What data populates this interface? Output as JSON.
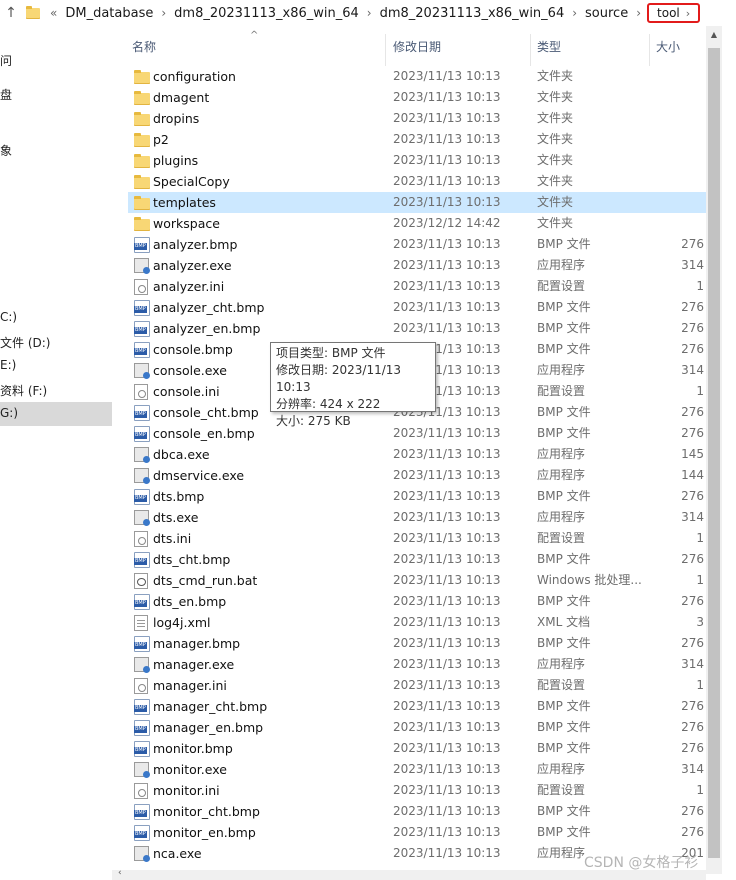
{
  "address_bar": {
    "back_glyph": "«",
    "crumbs": [
      "DM_database",
      "dm8_20231113_x86_win_64",
      "dm8_20231113_x86_win_64",
      "source"
    ],
    "active_crumb": "tool"
  },
  "nav_pane": {
    "items": [
      "问",
      "盘",
      "象",
      "C:)",
      "文件 (D:)",
      "E:)",
      "资料 (F:)",
      "G:)"
    ]
  },
  "columns": {
    "name": "名称",
    "date": "修改日期",
    "type": "类型",
    "size": "大小"
  },
  "files": [
    {
      "name": "configuration",
      "date": "2023/11/13 10:13",
      "type": "文件夹",
      "size": "",
      "icon": "folder-icon"
    },
    {
      "name": "dmagent",
      "date": "2023/11/13 10:13",
      "type": "文件夹",
      "size": "",
      "icon": "folder-icon"
    },
    {
      "name": "dropins",
      "date": "2023/11/13 10:13",
      "type": "文件夹",
      "size": "",
      "icon": "folder-icon"
    },
    {
      "name": "p2",
      "date": "2023/11/13 10:13",
      "type": "文件夹",
      "size": "",
      "icon": "folder-icon"
    },
    {
      "name": "plugins",
      "date": "2023/11/13 10:13",
      "type": "文件夹",
      "size": "",
      "icon": "folder-icon"
    },
    {
      "name": "SpecialCopy",
      "date": "2023/11/13 10:13",
      "type": "文件夹",
      "size": "",
      "icon": "folder-icon"
    },
    {
      "name": "templates",
      "date": "2023/11/13 10:13",
      "type": "文件夹",
      "size": "",
      "icon": "folder-icon",
      "selected": true
    },
    {
      "name": "workspace",
      "date": "2023/12/12 14:42",
      "type": "文件夹",
      "size": "",
      "icon": "folder-icon"
    },
    {
      "name": "analyzer.bmp",
      "date": "2023/11/13 10:13",
      "type": "BMP 文件",
      "size": "276",
      "icon": "bmp-file-icon"
    },
    {
      "name": "analyzer.exe",
      "date": "2023/11/13 10:13",
      "type": "应用程序",
      "size": "314",
      "icon": "exe-file-icon"
    },
    {
      "name": "analyzer.ini",
      "date": "2023/11/13 10:13",
      "type": "配置设置",
      "size": "1",
      "icon": "ini-file-icon"
    },
    {
      "name": "analyzer_cht.bmp",
      "date": "2023/11/13 10:13",
      "type": "BMP 文件",
      "size": "276",
      "icon": "bmp-file-icon"
    },
    {
      "name": "analyzer_en.bmp",
      "date": "2023/11/13 10:13",
      "type": "BMP 文件",
      "size": "276",
      "icon": "bmp-file-icon"
    },
    {
      "name": "console.bmp",
      "date": "2023/11/13 10:13",
      "type": "BMP 文件",
      "size": "276",
      "icon": "bmp-file-icon"
    },
    {
      "name": "console.exe",
      "date": "2023/11/13 10:13",
      "type": "应用程序",
      "size": "314",
      "icon": "exe-file-icon"
    },
    {
      "name": "console.ini",
      "date": "2023/11/13 10:13",
      "type": "配置设置",
      "size": "1",
      "icon": "ini-file-icon"
    },
    {
      "name": "console_cht.bmp",
      "date": "2023/11/13 10:13",
      "type": "BMP 文件",
      "size": "276",
      "icon": "bmp-file-icon"
    },
    {
      "name": "console_en.bmp",
      "date": "2023/11/13 10:13",
      "type": "BMP 文件",
      "size": "276",
      "icon": "bmp-file-icon"
    },
    {
      "name": "dbca.exe",
      "date": "2023/11/13 10:13",
      "type": "应用程序",
      "size": "145",
      "icon": "exe-file-icon"
    },
    {
      "name": "dmservice.exe",
      "date": "2023/11/13 10:13",
      "type": "应用程序",
      "size": "144",
      "icon": "exe-file-icon"
    },
    {
      "name": "dts.bmp",
      "date": "2023/11/13 10:13",
      "type": "BMP 文件",
      "size": "276",
      "icon": "bmp-file-icon"
    },
    {
      "name": "dts.exe",
      "date": "2023/11/13 10:13",
      "type": "应用程序",
      "size": "314",
      "icon": "exe-file-icon"
    },
    {
      "name": "dts.ini",
      "date": "2023/11/13 10:13",
      "type": "配置设置",
      "size": "1",
      "icon": "ini-file-icon"
    },
    {
      "name": "dts_cht.bmp",
      "date": "2023/11/13 10:13",
      "type": "BMP 文件",
      "size": "276",
      "icon": "bmp-file-icon"
    },
    {
      "name": "dts_cmd_run.bat",
      "date": "2023/11/13 10:13",
      "type": "Windows 批处理...",
      "size": "1",
      "icon": "bat-file-icon"
    },
    {
      "name": "dts_en.bmp",
      "date": "2023/11/13 10:13",
      "type": "BMP 文件",
      "size": "276",
      "icon": "bmp-file-icon"
    },
    {
      "name": "log4j.xml",
      "date": "2023/11/13 10:13",
      "type": "XML 文档",
      "size": "3",
      "icon": "xml-file-icon"
    },
    {
      "name": "manager.bmp",
      "date": "2023/11/13 10:13",
      "type": "BMP 文件",
      "size": "276",
      "icon": "bmp-file-icon"
    },
    {
      "name": "manager.exe",
      "date": "2023/11/13 10:13",
      "type": "应用程序",
      "size": "314",
      "icon": "exe-file-icon"
    },
    {
      "name": "manager.ini",
      "date": "2023/11/13 10:13",
      "type": "配置设置",
      "size": "1",
      "icon": "ini-file-icon"
    },
    {
      "name": "manager_cht.bmp",
      "date": "2023/11/13 10:13",
      "type": "BMP 文件",
      "size": "276",
      "icon": "bmp-file-icon"
    },
    {
      "name": "manager_en.bmp",
      "date": "2023/11/13 10:13",
      "type": "BMP 文件",
      "size": "276",
      "icon": "bmp-file-icon"
    },
    {
      "name": "monitor.bmp",
      "date": "2023/11/13 10:13",
      "type": "BMP 文件",
      "size": "276",
      "icon": "bmp-file-icon"
    },
    {
      "name": "monitor.exe",
      "date": "2023/11/13 10:13",
      "type": "应用程序",
      "size": "314",
      "icon": "exe-file-icon"
    },
    {
      "name": "monitor.ini",
      "date": "2023/11/13 10:13",
      "type": "配置设置",
      "size": "1",
      "icon": "ini-file-icon"
    },
    {
      "name": "monitor_cht.bmp",
      "date": "2023/11/13 10:13",
      "type": "BMP 文件",
      "size": "276",
      "icon": "bmp-file-icon"
    },
    {
      "name": "monitor_en.bmp",
      "date": "2023/11/13 10:13",
      "type": "BMP 文件",
      "size": "276",
      "icon": "bmp-file-icon"
    },
    {
      "name": "nca.exe",
      "date": "2023/11/13 10:13",
      "type": "应用程序",
      "size": "201",
      "icon": "exe-file-icon"
    }
  ],
  "tooltip": {
    "line1": "项目类型: BMP 文件",
    "line2": "修改日期: 2023/11/13 10:13",
    "line3": "分辨率: 424 x 222",
    "line4": "大小: 275 KB"
  },
  "watermark": "CSDN @女格子衫",
  "colors": {
    "selection": "#cce8ff",
    "highlight_box": "#e21b1b",
    "folder": "#f8d775"
  }
}
